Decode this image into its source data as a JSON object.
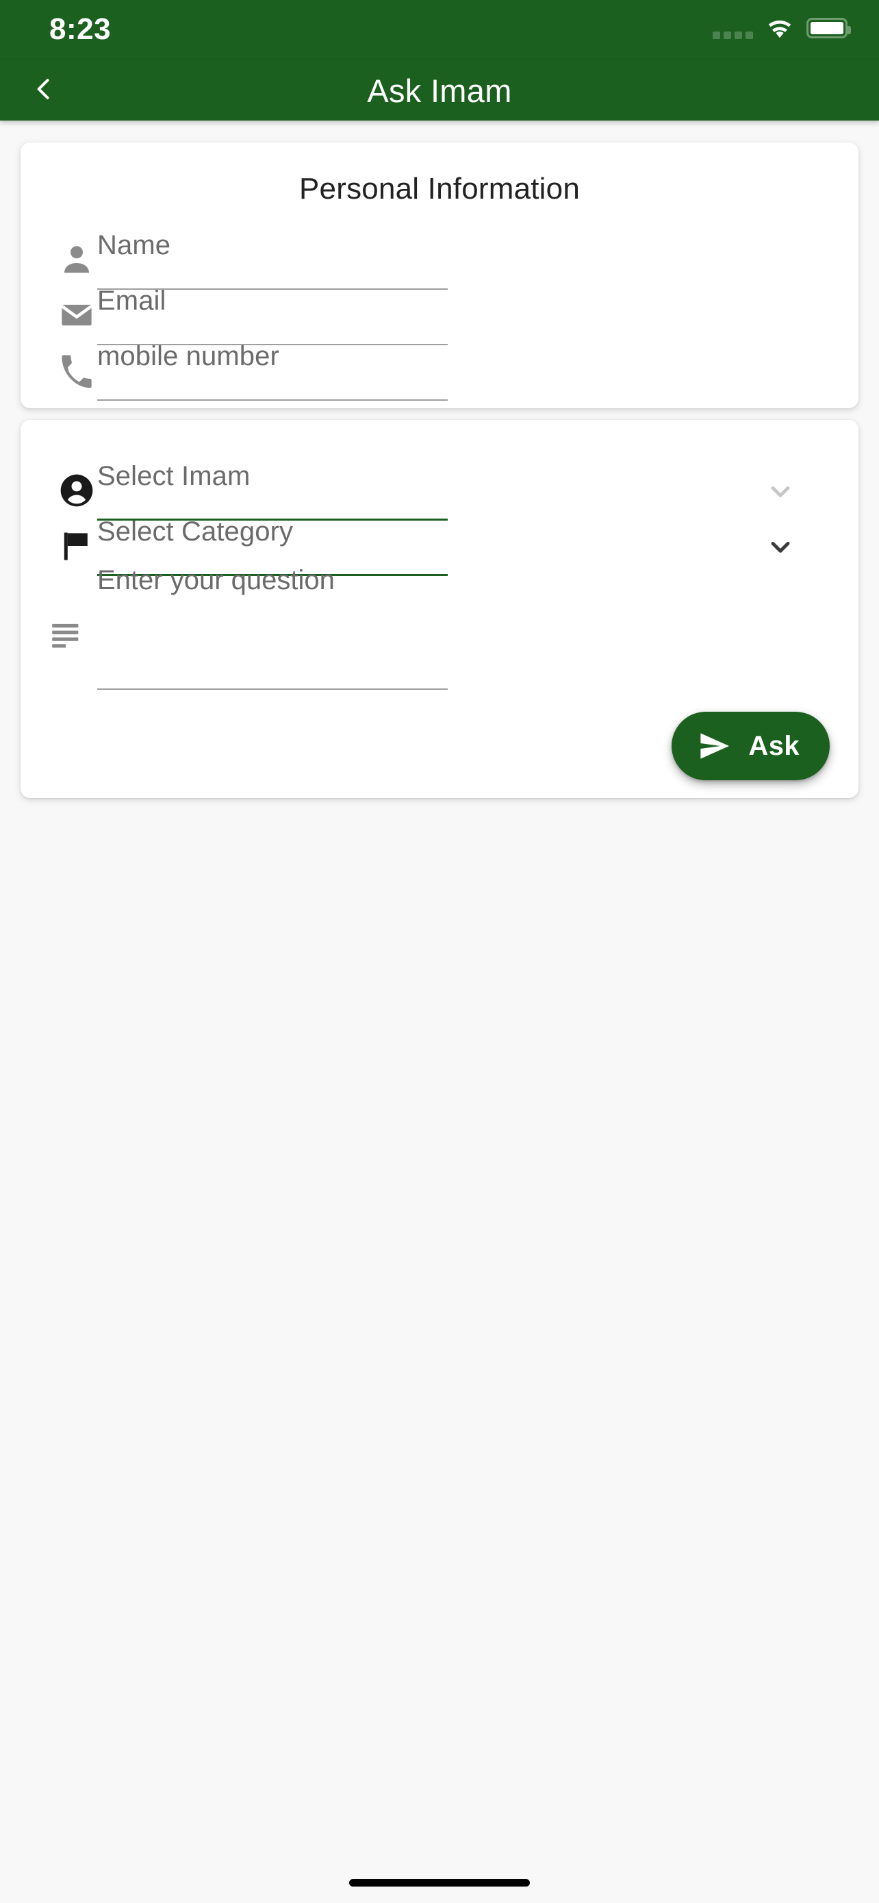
{
  "status_bar": {
    "time": "8:23",
    "signal_icon": "cellular-dots-icon",
    "wifi_icon": "wifi-icon",
    "battery_icon": "battery-full-icon"
  },
  "app_bar": {
    "back_icon": "chevron-left-icon",
    "title": "Ask Imam",
    "background_color": "#1b601f"
  },
  "personal_card": {
    "title": "Personal Information",
    "fields": [
      {
        "icon": "person-icon",
        "placeholder": "Name",
        "value": "",
        "underline_color": "#9e9e9e"
      },
      {
        "icon": "email-icon",
        "placeholder": "Email",
        "value": "",
        "underline_color": "#9e9e9e"
      },
      {
        "icon": "phone-icon",
        "placeholder": "mobile number",
        "value": "",
        "underline_color": "#9e9e9e"
      }
    ]
  },
  "question_card": {
    "dropdowns": [
      {
        "icon": "account-circle-icon",
        "placeholder": "Select Imam",
        "value": "",
        "chevron_icon": "chevron-down-icon",
        "chevron_color": "#c6c6c6",
        "underline_color": "#1b601f"
      },
      {
        "icon": "flag-icon",
        "placeholder": "Select Category",
        "value": "",
        "chevron_icon": "chevron-down-icon",
        "chevron_color": "#3c3c3c",
        "underline_color": "#1b601f"
      }
    ],
    "question": {
      "icon": "notes-icon",
      "placeholder": "Enter your question",
      "value": "",
      "underline_color": "#9e9e9e"
    },
    "submit": {
      "label": "Ask",
      "icon": "send-icon",
      "background_color": "#1b601f",
      "text_color": "#ffffff"
    }
  },
  "home_indicator": "home-indicator"
}
